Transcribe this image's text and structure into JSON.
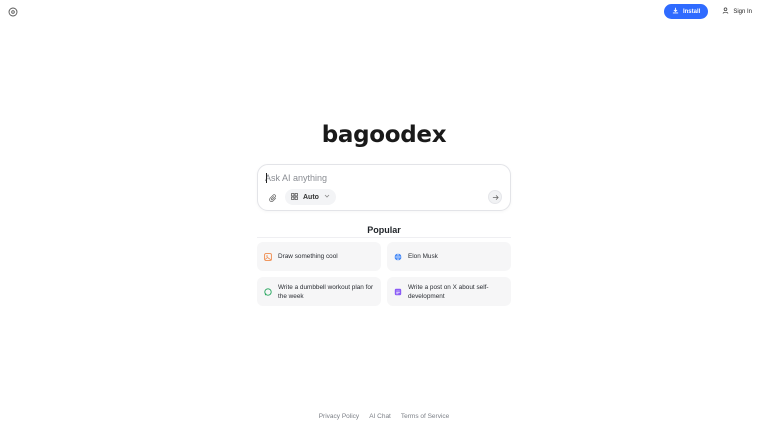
{
  "header": {
    "left_icon": "settings-circle-icon",
    "install_label": "Install",
    "install_icon": "download-icon",
    "signin_label": "Sign In",
    "signin_icon": "user-icon"
  },
  "logo": {
    "text": "bagoodex"
  },
  "search": {
    "placeholder": "Ask AI anything",
    "value": "",
    "attach_icon": "paperclip-icon",
    "mode_label": "Auto",
    "mode_icon": "grid-icon",
    "send_icon": "arrow-right-icon"
  },
  "popular": {
    "title": "Popular",
    "items": [
      {
        "label": "Draw something cool",
        "icon": "image-icon",
        "color": "#f08a4b"
      },
      {
        "label": "Elon Musk",
        "icon": "globe-icon",
        "color": "#3b82f6"
      },
      {
        "label": "Write a dumbbell workout plan for the week",
        "icon": "chat-icon",
        "color": "#22a55b"
      },
      {
        "label": "Write a post on X about self-development",
        "icon": "document-icon",
        "color": "#8b5cf6"
      }
    ]
  },
  "footer": {
    "links": [
      "Privacy Policy",
      "AI Chat",
      "Terms of Service"
    ]
  },
  "colors": {
    "accent": "#2f6bff"
  }
}
